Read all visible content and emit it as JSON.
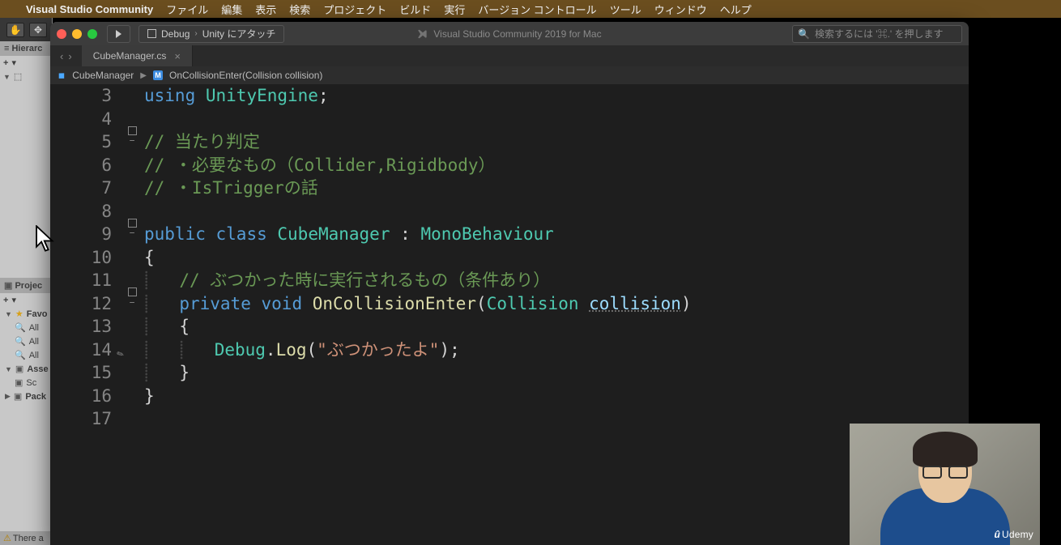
{
  "menubar": {
    "app_name": "Visual Studio Community",
    "items": [
      "ファイル",
      "編集",
      "表示",
      "検索",
      "プロジェクト",
      "ビルド",
      "実行",
      "バージョン コントロール",
      "ツール",
      "ウィンドウ",
      "ヘルプ"
    ]
  },
  "unity": {
    "hierarchy_label": "Hierarc",
    "plus": "+",
    "project_label": "Projec",
    "favorites": "Favo",
    "all_a": "All",
    "all_b": "All",
    "all_c": "All",
    "assets": "Asse",
    "scripts": "Sc",
    "packages": "Pack",
    "status": "There a"
  },
  "vs": {
    "target_config": "Debug",
    "target_attach": "Unity にアタッチ",
    "title": "Visual Studio Community 2019 for Mac",
    "search_placeholder": "検索するには '⌘.' を押します",
    "tab_label": "CubeManager.cs",
    "breadcrumb_class": "CubeManager",
    "breadcrumb_method": "OnCollisionEnter(Collision collision)"
  },
  "code": {
    "lines": [
      {
        "n": "3",
        "fold": "",
        "html": "<span class='c-kw'>using</span> <span class='c-type'>UnityEngine</span><span class='c-punc'>;</span>"
      },
      {
        "n": "4",
        "fold": "",
        "html": ""
      },
      {
        "n": "5",
        "fold": "box",
        "html": "<span class='c-comment'>// 当たり判定</span>"
      },
      {
        "n": "6",
        "fold": "",
        "html": "<span class='c-comment'>// ・必要なもの（Collider,Rigidbody）</span>"
      },
      {
        "n": "7",
        "fold": "",
        "html": "<span class='c-comment'>// ・IsTriggerの話</span>"
      },
      {
        "n": "8",
        "fold": "",
        "html": ""
      },
      {
        "n": "9",
        "fold": "box",
        "html": "<span class='c-kw'>public</span> <span class='c-kw'>class</span> <span class='c-type'>CubeManager</span> <span class='c-punc'>:</span> <span class='c-type'>MonoBehaviour</span>"
      },
      {
        "n": "10",
        "fold": "",
        "html": "<span class='c-punc'>{</span>"
      },
      {
        "n": "11",
        "fold": "",
        "html": "<span class='guide'>⸽</span>   <span class='c-comment'>// ぶつかった時に実行されるもの（条件あり）</span>"
      },
      {
        "n": "12",
        "fold": "box",
        "html": "<span class='guide'>⸽</span>   <span class='c-kw'>private</span> <span class='c-kw'>void</span> <span class='c-method'>OnCollisionEnter</span><span class='c-punc'>(</span><span class='c-type'>Collision</span> <span class='c-param u'>collision</span><span class='c-punc'>)</span>"
      },
      {
        "n": "13",
        "fold": "",
        "html": "<span class='guide'>⸽</span>   <span class='c-punc'>{</span>"
      },
      {
        "n": "14",
        "fold": "",
        "mark": "✎",
        "html": "<span class='guide'>⸽</span>   <span class='guide'>⸽</span>   <span class='c-type'>Debug</span><span class='c-punc'>.</span><span class='c-method'>Log</span><span class='c-punc'>(</span><span class='c-string'>\"ぶつかったよ\"</span><span class='c-punc'>);</span>"
      },
      {
        "n": "15",
        "fold": "",
        "html": "<span class='guide'>⸽</span>   <span class='c-punc'>}</span>"
      },
      {
        "n": "16",
        "fold": "",
        "html": "<span class='c-punc'>}</span>"
      },
      {
        "n": "17",
        "fold": "",
        "html": ""
      }
    ]
  },
  "webcam": {
    "brand": "Udemy"
  }
}
